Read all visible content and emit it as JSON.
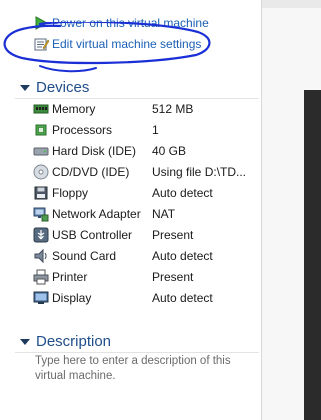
{
  "commands": {
    "power_on": "Power on this virtual machine",
    "edit_settings": "Edit virtual machine settings"
  },
  "devices_section": {
    "title": "Devices",
    "items": [
      {
        "name": "Memory",
        "value": "512 MB",
        "icon": "memory-icon"
      },
      {
        "name": "Processors",
        "value": "1",
        "icon": "processor-icon"
      },
      {
        "name": "Hard Disk (IDE)",
        "value": "40 GB",
        "icon": "hard-disk-icon"
      },
      {
        "name": "CD/DVD (IDE)",
        "value": "Using file D:\\TD...",
        "icon": "cd-dvd-icon"
      },
      {
        "name": "Floppy",
        "value": "Auto detect",
        "icon": "floppy-icon"
      },
      {
        "name": "Network Adapter",
        "value": "NAT",
        "icon": "network-adapter-icon"
      },
      {
        "name": "USB Controller",
        "value": "Present",
        "icon": "usb-controller-icon"
      },
      {
        "name": "Sound Card",
        "value": "Auto detect",
        "icon": "sound-card-icon"
      },
      {
        "name": "Printer",
        "value": "Present",
        "icon": "printer-icon"
      },
      {
        "name": "Display",
        "value": "Auto detect",
        "icon": "display-icon"
      }
    ]
  },
  "description_section": {
    "title": "Description",
    "placeholder": "Type here to enter a description of this virtual machine."
  },
  "colors": {
    "link": "#1a5fb4",
    "section_title": "#1f4e8c",
    "annotation_ink": "#1b2fd6"
  }
}
